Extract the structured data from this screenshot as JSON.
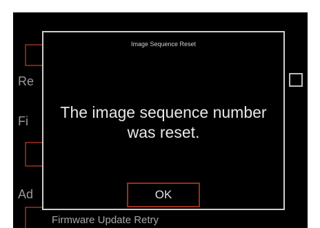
{
  "background_menu": {
    "header_text": "",
    "labels": [
      "Re",
      "Fi",
      "Ad"
    ],
    "footer_item": "Firmware Update Retry"
  },
  "dialog": {
    "title": "Image Sequence Reset",
    "message": "The image sequence number was reset.",
    "ok_label": "OK"
  },
  "colors": {
    "screen_background": "#000000",
    "accent_border": "#9a3018",
    "dialog_border": "#cfcfcf",
    "text": "#e8e8e8"
  }
}
